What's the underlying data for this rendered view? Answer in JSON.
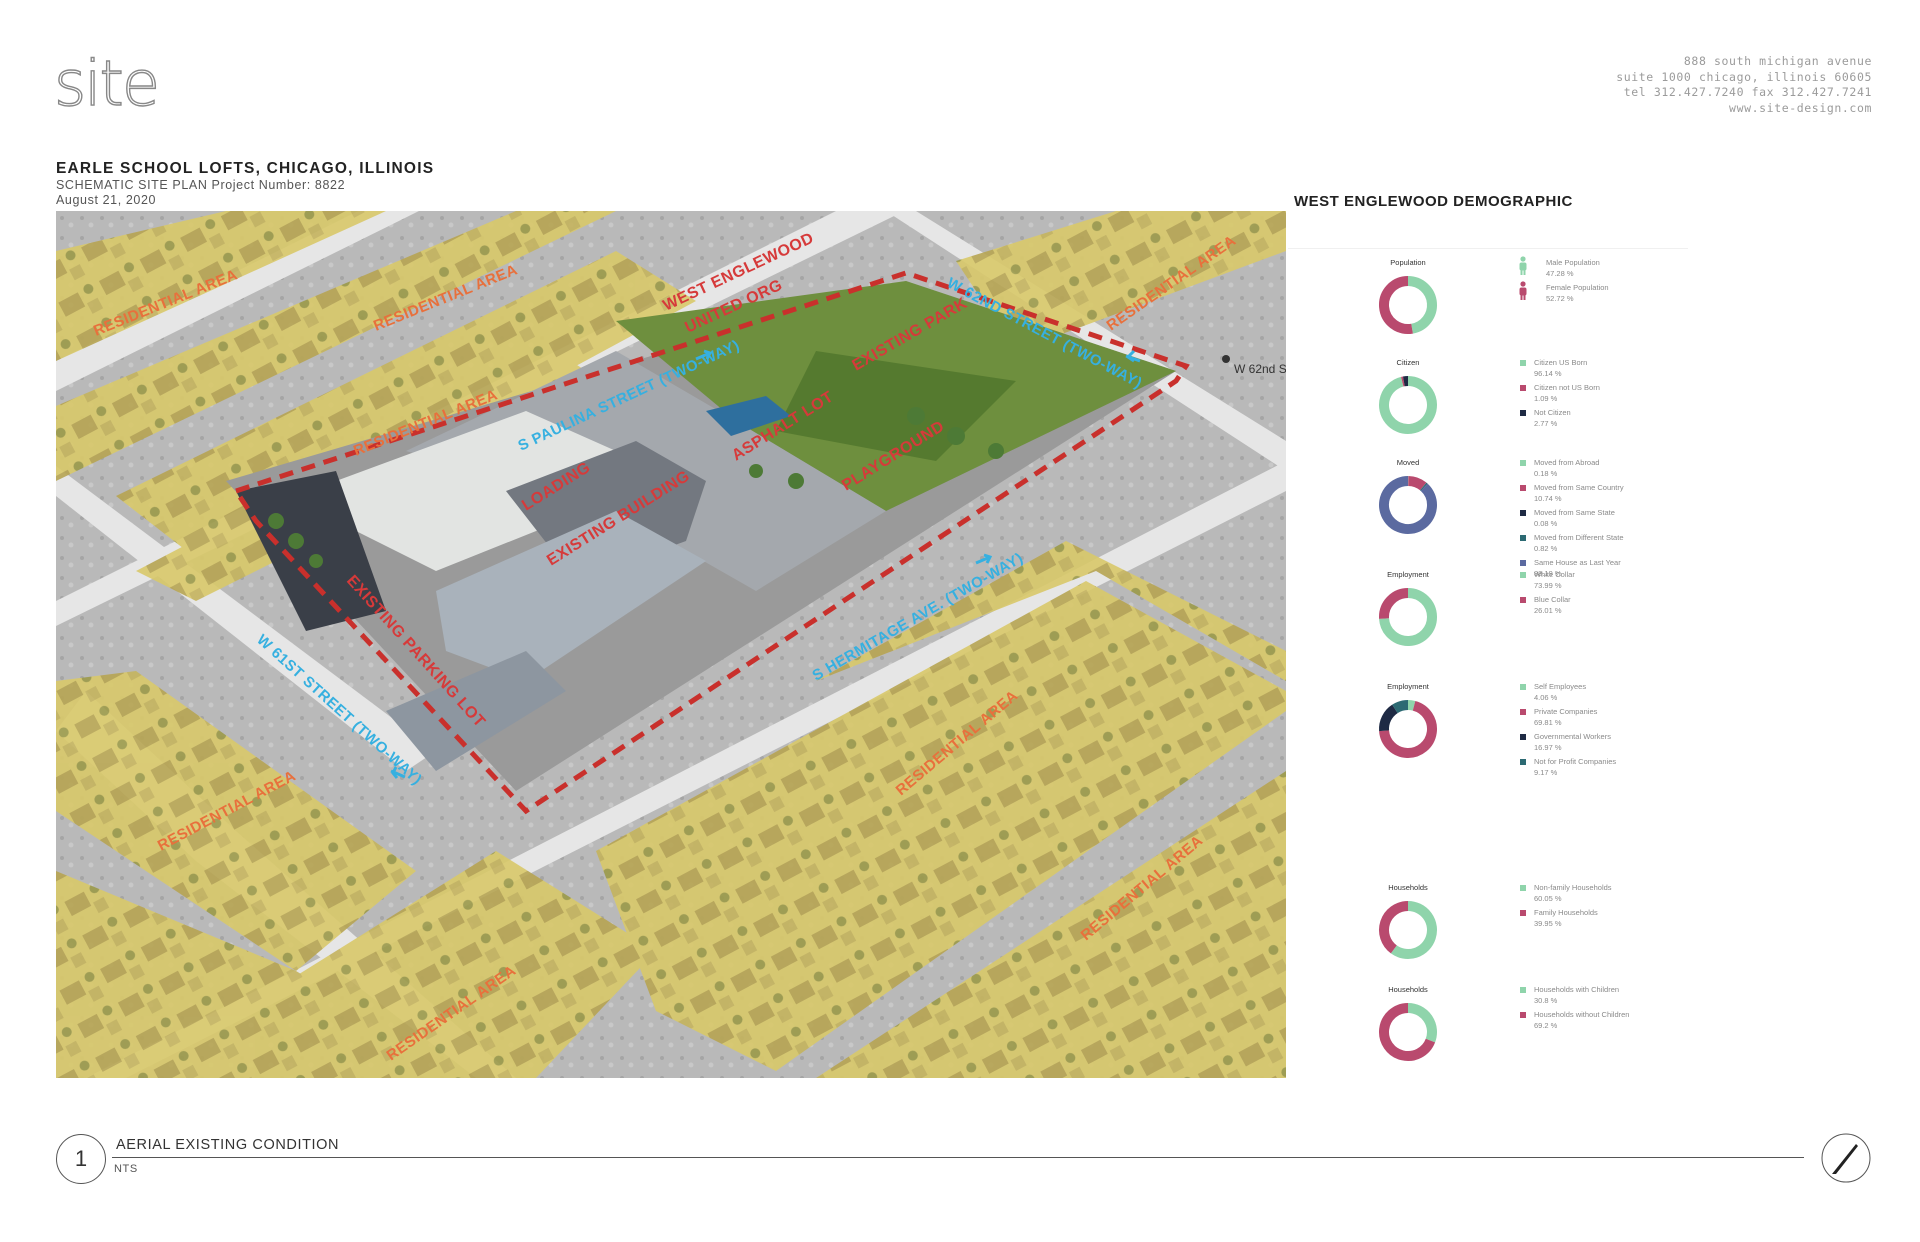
{
  "logo": {
    "text": "site"
  },
  "address": {
    "line1": "888 south michigan avenue",
    "line2": "suite 1000 chicago, illinois 60605",
    "line3": "tel 312.427.7240  fax 312.427.7241",
    "line4": "www.site-design.com"
  },
  "project": {
    "title": "EARLE SCHOOL LOFTS, CHICAGO, ILLINOIS",
    "subtitle": "SCHEMATIC SITE PLAN  Project Number: 8822",
    "date": "August 21, 2020"
  },
  "map": {
    "labels": {
      "residential": "RESIDENTIAL AREA",
      "west_englewood_1": "WEST ENGLEWOOD",
      "west_englewood_2": "UNITED ORG",
      "existing_park": "EXISTING PARK",
      "asphalt_lot": "ASPHALT LOT",
      "playground": "PLAYGROUND",
      "loading": "LOADING",
      "existing_building": "EXISTING BUILDING",
      "existing_parking_lot": "EXISTING PARKING LOT",
      "s_paulina": "S PAULINA STREET (TWO-WAY)",
      "w_62nd": "W 62ND STREET (TWO-WAY)",
      "s_hermitage": "S HERMITAGE AVE. (TWO-WAY)",
      "w_61st": "W 61ST STREET (TWO-WAY)",
      "w_62nd_pin": "W 62nd St"
    },
    "colors": {
      "site_boundary": "#d03434",
      "street_label": "#36b0e0",
      "area_label": "#e8703c",
      "site_label": "#d63a3a",
      "residential_overlay": "#e6d77a"
    }
  },
  "demographic": {
    "title": "WEST ENGLEWOOD DEMOGRAPHIC",
    "charts": [
      {
        "label": "Population",
        "segments": [
          {
            "name": "Male Population",
            "value": 47.28,
            "display": "47.28 %",
            "color": "#8fd4ab",
            "icon": "male-icon"
          },
          {
            "name": "Female Population",
            "value": 52.72,
            "display": "52.72 %",
            "color": "#b94a6e",
            "icon": "female-icon"
          }
        ]
      },
      {
        "label": "Citizen",
        "segments": [
          {
            "name": "Citizen US Born",
            "value": 96.14,
            "display": "96.14 %",
            "color": "#8fd4ab"
          },
          {
            "name": "Citizen not US Born",
            "value": 1.09,
            "display": "1.09 %",
            "color": "#b94a6e"
          },
          {
            "name": "Not Citizen",
            "value": 2.77,
            "display": "2.77 %",
            "color": "#1e2a44"
          }
        ]
      },
      {
        "label": "Moved",
        "segments": [
          {
            "name": "Moved from Abroad",
            "value": 0.18,
            "display": "0.18 %",
            "color": "#8fd4ab"
          },
          {
            "name": "Moved from Same Country",
            "value": 10.74,
            "display": "10.74 %",
            "color": "#b94a6e"
          },
          {
            "name": "Moved from Same State",
            "value": 0.08,
            "display": "0.08 %",
            "color": "#1e2a44"
          },
          {
            "name": "Moved from Different State",
            "value": 0.82,
            "display": "0.82 %",
            "color": "#2c6a73"
          },
          {
            "name": "Same House as Last Year",
            "value": 88.19,
            "display": "88.19 %",
            "color": "#5b6aa0"
          }
        ]
      },
      {
        "label": "Employment",
        "segments": [
          {
            "name": "White Collar",
            "value": 73.99,
            "display": "73.99 %",
            "color": "#8fd4ab"
          },
          {
            "name": "Blue Collar",
            "value": 26.01,
            "display": "26.01 %",
            "color": "#b94a6e"
          }
        ]
      },
      {
        "label": "Employment",
        "segments": [
          {
            "name": "Self Employees",
            "value": 4.06,
            "display": "4.06 %",
            "color": "#8fd4ab"
          },
          {
            "name": "Private Companies",
            "value": 69.81,
            "display": "69.81 %",
            "color": "#b94a6e"
          },
          {
            "name": "Governmental Workers",
            "value": 16.97,
            "display": "16.97 %",
            "color": "#1e2a44"
          },
          {
            "name": "Not for Profit Companies",
            "value": 9.17,
            "display": "9.17 %",
            "color": "#2c6a73"
          }
        ]
      },
      {
        "label": "Households",
        "segments": [
          {
            "name": "Non-family Households",
            "value": 60.05,
            "display": "60.05 %",
            "color": "#8fd4ab"
          },
          {
            "name": "Family Households",
            "value": 39.95,
            "display": "39.95 %",
            "color": "#b94a6e"
          }
        ]
      },
      {
        "label": "Households",
        "segments": [
          {
            "name": "Households with Children",
            "value": 30.8,
            "display": "30.8 %",
            "color": "#8fd4ab"
          },
          {
            "name": "Households without Children",
            "value": 69.2,
            "display": "69.2 %",
            "color": "#b94a6e"
          }
        ]
      }
    ]
  },
  "footer": {
    "view_number": "1",
    "view_title": "AERIAL EXISTING CONDITION",
    "scale": "NTS"
  }
}
